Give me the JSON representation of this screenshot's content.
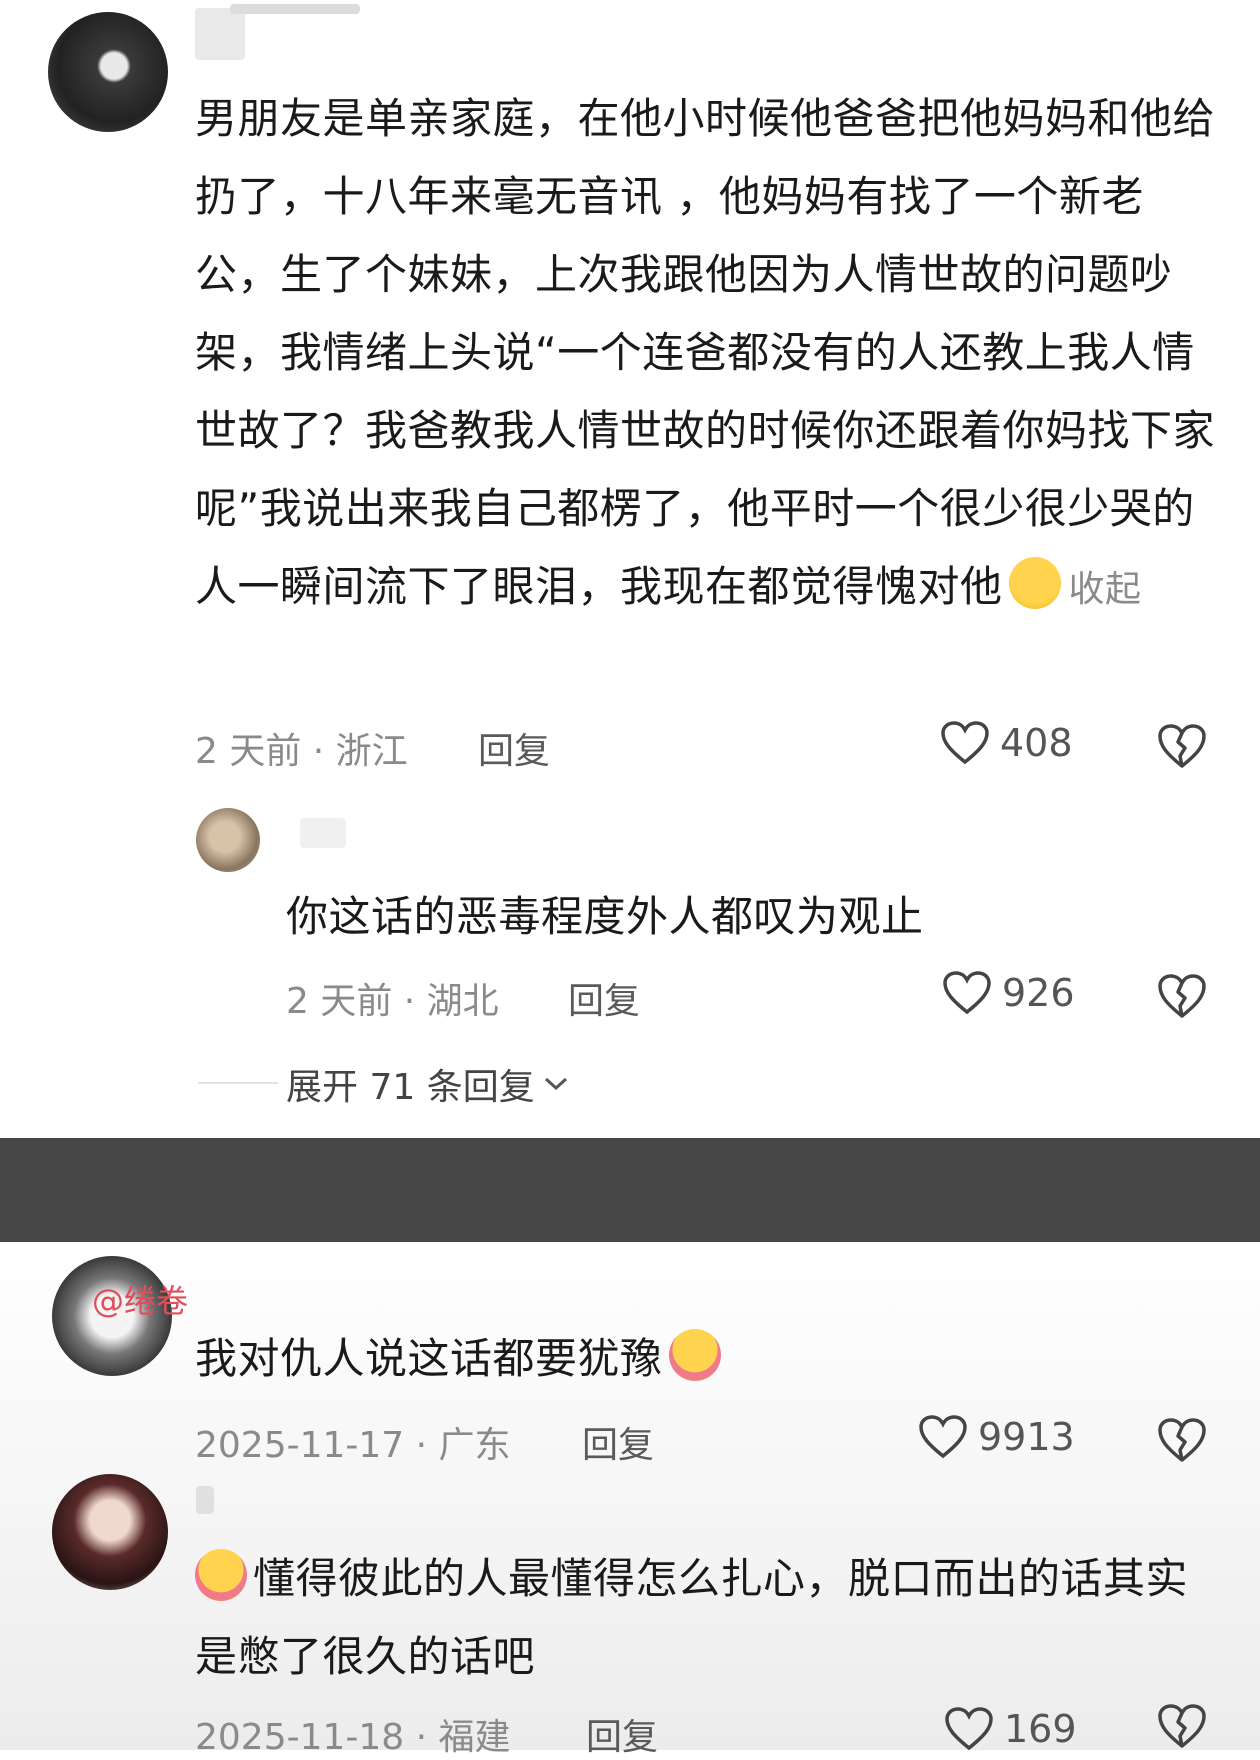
{
  "comments": [
    {
      "text": "男朋友是单亲家庭，在他小时候他爸爸把他妈妈和他给扔了，十八年来毫无音讯 ，他妈妈有找了一个新老公，生了个妹妹，上次我跟他因为人情世故的问题吵架，我情绪上头说“一个连爸都没有的人还教上我人情世故了？我爸教我人情世故的时候你还跟着你妈找下家呢”我说出来我自己都楞了，他平时一个很少很少哭的人一瞬间流下了眼泪，我现在都觉得愧对他",
      "collapse_label": "收起",
      "meta": "2 天前 · 浙江",
      "reply_label": "回复",
      "likes": "408",
      "emoji_icon": "crying-face-icon"
    },
    {
      "text": "你这话的恶毒程度外人都叹为观止",
      "meta": "2 天前 · 湖北",
      "reply_label": "回复",
      "likes": "926"
    }
  ],
  "expand_replies": "展开 71 条回复",
  "lower_comments": [
    {
      "mention": "@绻卷",
      "text": "我对仇人说这话都要犹豫",
      "meta": "2025-11-17 · 广东",
      "reply_label": "回复",
      "likes": "9913",
      "emoji_icon": "hugging-face-icon"
    },
    {
      "text": "懂得彼此的人最懂得怎么扎心，脱口而出的话其实是憋了很久的话吧",
      "meta": "2025-11-18 · 福建",
      "reply_label": "回复",
      "likes": "169",
      "emoji_icon": "hugging-face-icon"
    }
  ],
  "colors": {
    "band": "#474747",
    "mention": "#e04e5a",
    "meta": "#8a8a8a"
  }
}
